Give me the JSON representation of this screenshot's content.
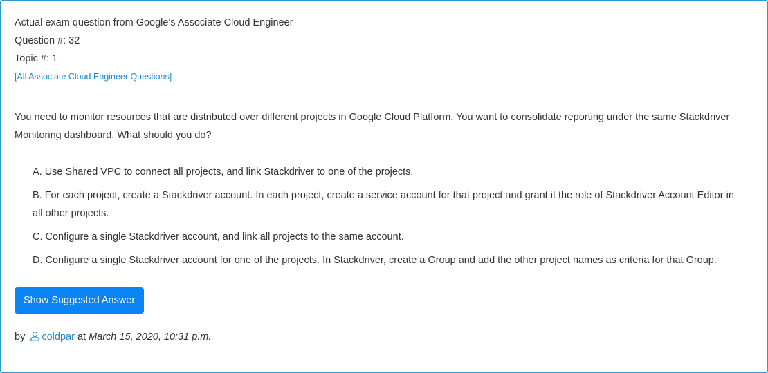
{
  "header": {
    "source_line": "Actual exam question from Google's Associate Cloud Engineer",
    "question_number": "Question #: 32",
    "topic_number": "Topic #: 1",
    "all_questions_link": "[All Associate Cloud Engineer Questions]"
  },
  "question": {
    "text": "You need to monitor resources that are distributed over different projects in Google Cloud Platform. You want to consolidate reporting under the same Stackdriver Monitoring dashboard. What should you do?"
  },
  "choices": [
    {
      "letter": "A.",
      "text": "Use Shared VPC to connect all projects, and link Stackdriver to one of the projects."
    },
    {
      "letter": "B.",
      "text": "For each project, create a Stackdriver account. In each project, create a service account for that project and grant it the role of Stackdriver Account Editor in all other projects."
    },
    {
      "letter": "C.",
      "text": "Configure a single Stackdriver account, and link all projects to the same account."
    },
    {
      "letter": "D.",
      "text": "Configure a single Stackdriver account for one of the projects. In Stackdriver, create a Group and add the other project names as criteria for that Group."
    }
  ],
  "actions": {
    "show_answer_label": "Show Suggested Answer"
  },
  "byline": {
    "by_label": "by",
    "user_icon": "user-icon",
    "username": "coldpar",
    "at_label": "at",
    "posted_at": "March 15, 2020, 10:31 p.m."
  },
  "colors": {
    "accent": "#0a84f5",
    "link": "#1a8ad6",
    "card_border": "#2d9bd6",
    "text": "#333333"
  }
}
